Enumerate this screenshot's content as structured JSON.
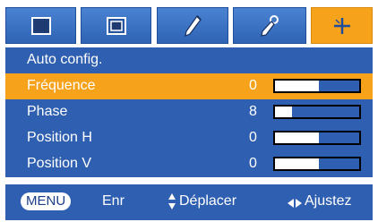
{
  "tabs": [
    {
      "icon": "screen-picture-icon",
      "active": false
    },
    {
      "icon": "screen-window-icon",
      "active": false
    },
    {
      "icon": "pen-icon",
      "active": false
    },
    {
      "icon": "pen-settings-icon",
      "active": false
    },
    {
      "icon": "setup-plus-icon",
      "active": true
    }
  ],
  "menu": {
    "items": [
      {
        "label": "Auto config.",
        "value": "",
        "has_bar": false,
        "selected": false
      },
      {
        "label": "Fréquence",
        "value": "0",
        "has_bar": true,
        "level": 0.52,
        "selected": true
      },
      {
        "label": "Phase",
        "value": "8",
        "has_bar": true,
        "level": 0.2,
        "selected": false
      },
      {
        "label": "Position H",
        "value": "0",
        "has_bar": true,
        "level": 0.52,
        "selected": false
      },
      {
        "label": "Position V",
        "value": "0",
        "has_bar": true,
        "level": 0.52,
        "selected": false
      }
    ]
  },
  "footer": {
    "menu_key": "MENU",
    "save_label": "Enr",
    "move_label": "Déplacer",
    "adjust_label": "Ajustez"
  },
  "colors": {
    "panel_blue": "#2f5fb0",
    "highlight_orange": "#f6a21a",
    "tab_blue": "#3a72c4"
  }
}
